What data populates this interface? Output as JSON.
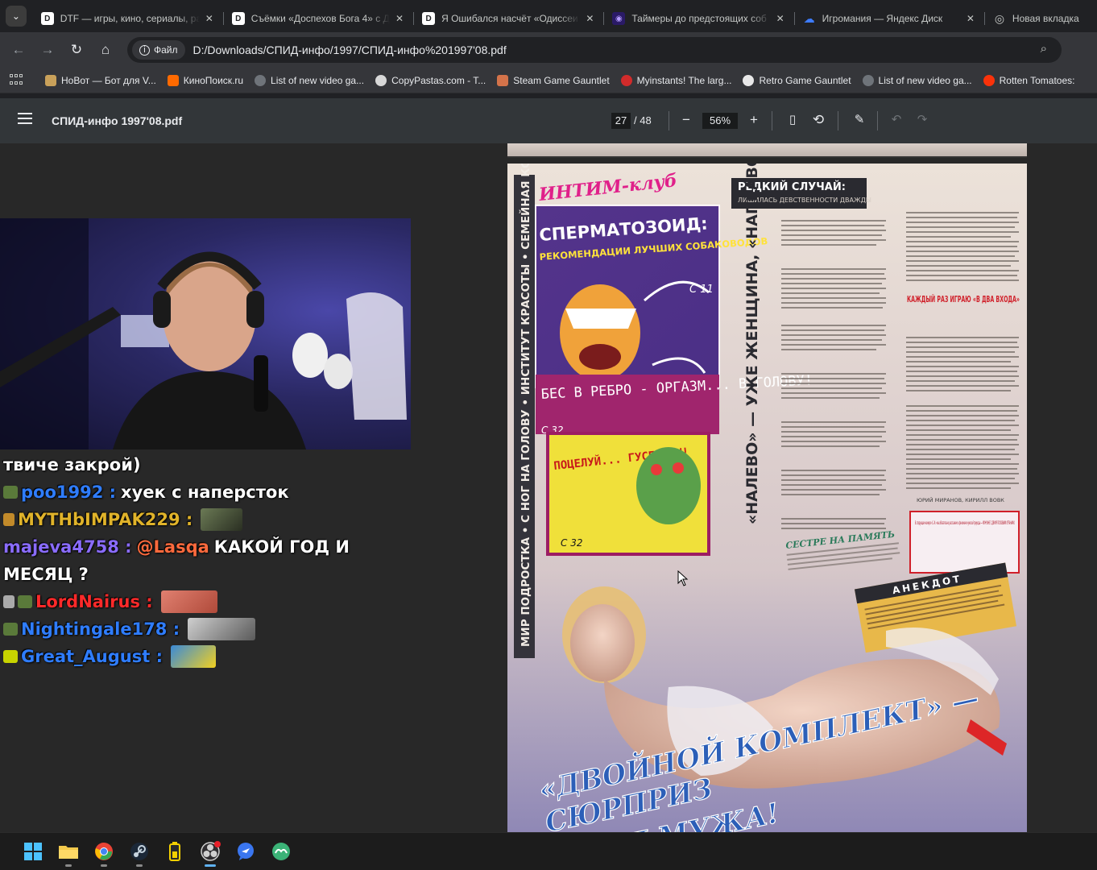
{
  "tabs": [
    {
      "title": "DTF — игры, кино, сериалы, ра",
      "favicon_color": "#ffffff",
      "favicon_glyph": "D"
    },
    {
      "title": "Съёмки «Доспехов Бога 4» с Д",
      "favicon_color": "#ffffff",
      "favicon_glyph": "D"
    },
    {
      "title": "Я Ошибался насчёт «Одиссеи",
      "favicon_color": "#ffffff",
      "favicon_glyph": "D"
    },
    {
      "title": "Таймеры до предстоящих соб",
      "favicon_color": "#6a3bd6",
      "favicon_glyph": "◉"
    },
    {
      "title": "Игромания — Яндекс Диск",
      "favicon_color": "#3d7cff",
      "favicon_glyph": "☁"
    },
    {
      "title": "Новая вкладка",
      "favicon_color": "#c4c7c5",
      "favicon_glyph": "◎"
    }
  ],
  "toolbar": {
    "file_chip": "Файл",
    "url": "D:/Downloads/СПИД-инфо/1997/СПИД-инфо%201997'08.pdf"
  },
  "bookmarks": [
    {
      "label": "НоВот — Бот для V...",
      "color": "#c9a15a"
    },
    {
      "label": "КиноПоиск.ru",
      "color": "#ff6a00"
    },
    {
      "label": "List of new video ga...",
      "color": "#9aa0a6"
    },
    {
      "label": "CopyPastas.com - T...",
      "color": "#d8d8d8"
    },
    {
      "label": "Steam Game Gauntlet",
      "color": "#d4734a"
    },
    {
      "label": "Myinstants! The larg...",
      "color": "#d12b2b"
    },
    {
      "label": "Retro Game Gauntlet",
      "color": "#e8e8e8"
    },
    {
      "label": "List of new video ga...",
      "color": "#9aa0a6"
    },
    {
      "label": "Rotten Tomatoes:",
      "color": "#fa320a"
    }
  ],
  "pdf": {
    "title": "СПИД-инфо 1997'08.pdf",
    "current_page": "27",
    "total_pages": "/ 48",
    "zoom": "56%"
  },
  "chat": [
    {
      "user": "",
      "text": "твиче закрой)",
      "user_color": "#ffffff",
      "badges": []
    },
    {
      "user": "poo1992 :",
      "text": "хуек с наперсток",
      "user_color": "#2f7dff",
      "badges": [
        "#5a7a3a"
      ]
    },
    {
      "user": "MYTHbIMPAK229 :",
      "text": "",
      "user_color": "#e0b32a",
      "badges": [
        "#c28a2a"
      ],
      "emote": {
        "width": 52,
        "color": "#6b7a55"
      }
    },
    {
      "user": "majeva4758 :",
      "text_mention": "@Lasqa",
      "text": "КАКОЙ ГОД И",
      "user_color": "#8a6cff",
      "mention_color": "#ff6a3d",
      "badges": []
    },
    {
      "user": "",
      "text": "МЕСЯЦ ?",
      "user_color": "#ffffff",
      "badges": []
    },
    {
      "user": "LordNairus :",
      "text": "",
      "user_color": "#ff2a2a",
      "badges": [
        "#aaaaaa",
        "#5a7a3a"
      ],
      "emote": {
        "width": 70,
        "color": "#e08070"
      }
    },
    {
      "user": "Nightingale178 :",
      "text": "",
      "user_color": "#2f7dff",
      "badges": [
        "#5a7a3a"
      ],
      "emote": {
        "width": 84,
        "color": "#9a9a9a"
      }
    },
    {
      "user": "Great_August :",
      "text": "",
      "user_color": "#2f7dff",
      "badges": [
        "#c8d400"
      ],
      "emote": {
        "width": 56,
        "color": "#3a8ad8"
      }
    }
  ],
  "magazine": {
    "heading_top": "ИНТИМ-клуб",
    "spermatozoid_title": "СПЕРМАТОЗОИД:",
    "spermatozoid_sub": "РЕКОМЕНДАЦИИ ЛУЧШИХ СОБАКОВОДОВ",
    "page_ref_1": "С 11",
    "bes_text": "БЕС В РЕБРО - ОРГАЗМ... В ГОЛОВУ!",
    "page_ref_2": "С 32",
    "poceluy": "ПОЦЕЛУЙ... ГУСЕНИЦЫ!",
    "page_ref_3": "С 32",
    "sidebar_vertical": "МИР ПОДРОСТКА • С НОГ НА ГОЛОВУ • ИНСТИТУТ КРАСОТЫ • СЕМЕЙНАЯ КОНСУЛЬТАЦИЯ",
    "redkiy_title": "РЕДКИЙ СЛУЧАЙ:",
    "redkiy_sub": "ЛИШИЛАСЬ ДЕВСТВЕННОСТИ ДВАЖДЫ",
    "nalevo": "«НАЛЕВО» — УЖЕ ЖЕНЩИНА, «НАПРАВО» — ЕЩЕ ДЕВОЧКА...",
    "kazhdy": "КАЖДЫЙ РАЗ ИГРАЮ «В ДВА ВХОДА»",
    "sestre": "СЕСТРЕ НА ПАМЯТЬ",
    "anekdot": "АНЕКДОТ",
    "next_issue": "В следующем номере «С.-И.» мы обязательно расскажем о феномене мужской природы — МУЖЧИНЕ С ДВУМЯ ПОЛОВЫМИ ОРГАНАМИ.",
    "headline_1": "«ДВОЙНОЙ КОМПЛЕКТ» —",
    "headline_2": "СЮРПРИЗ",
    "headline_3": "ДЛЯ МУЖА!",
    "signature": "ЮРИЙ МИРАНОВ, КИРИЛЛ ВОВК"
  },
  "taskbar": [
    {
      "name": "start",
      "color": "#4cc2ff",
      "active": false
    },
    {
      "name": "explorer",
      "color": "#f2c94c",
      "active": false
    },
    {
      "name": "chrome",
      "color": "#e94335",
      "active": false
    },
    {
      "name": "steam",
      "color": "#c7d5e0",
      "active": false
    },
    {
      "name": "battery-app",
      "color": "#f5d000",
      "active": false
    },
    {
      "name": "obs",
      "color": "#d0d0d0",
      "active": true
    },
    {
      "name": "messenger",
      "color": "#3a76f0",
      "active": false
    },
    {
      "name": "app-green",
      "color": "#3bb377",
      "active": false
    }
  ]
}
